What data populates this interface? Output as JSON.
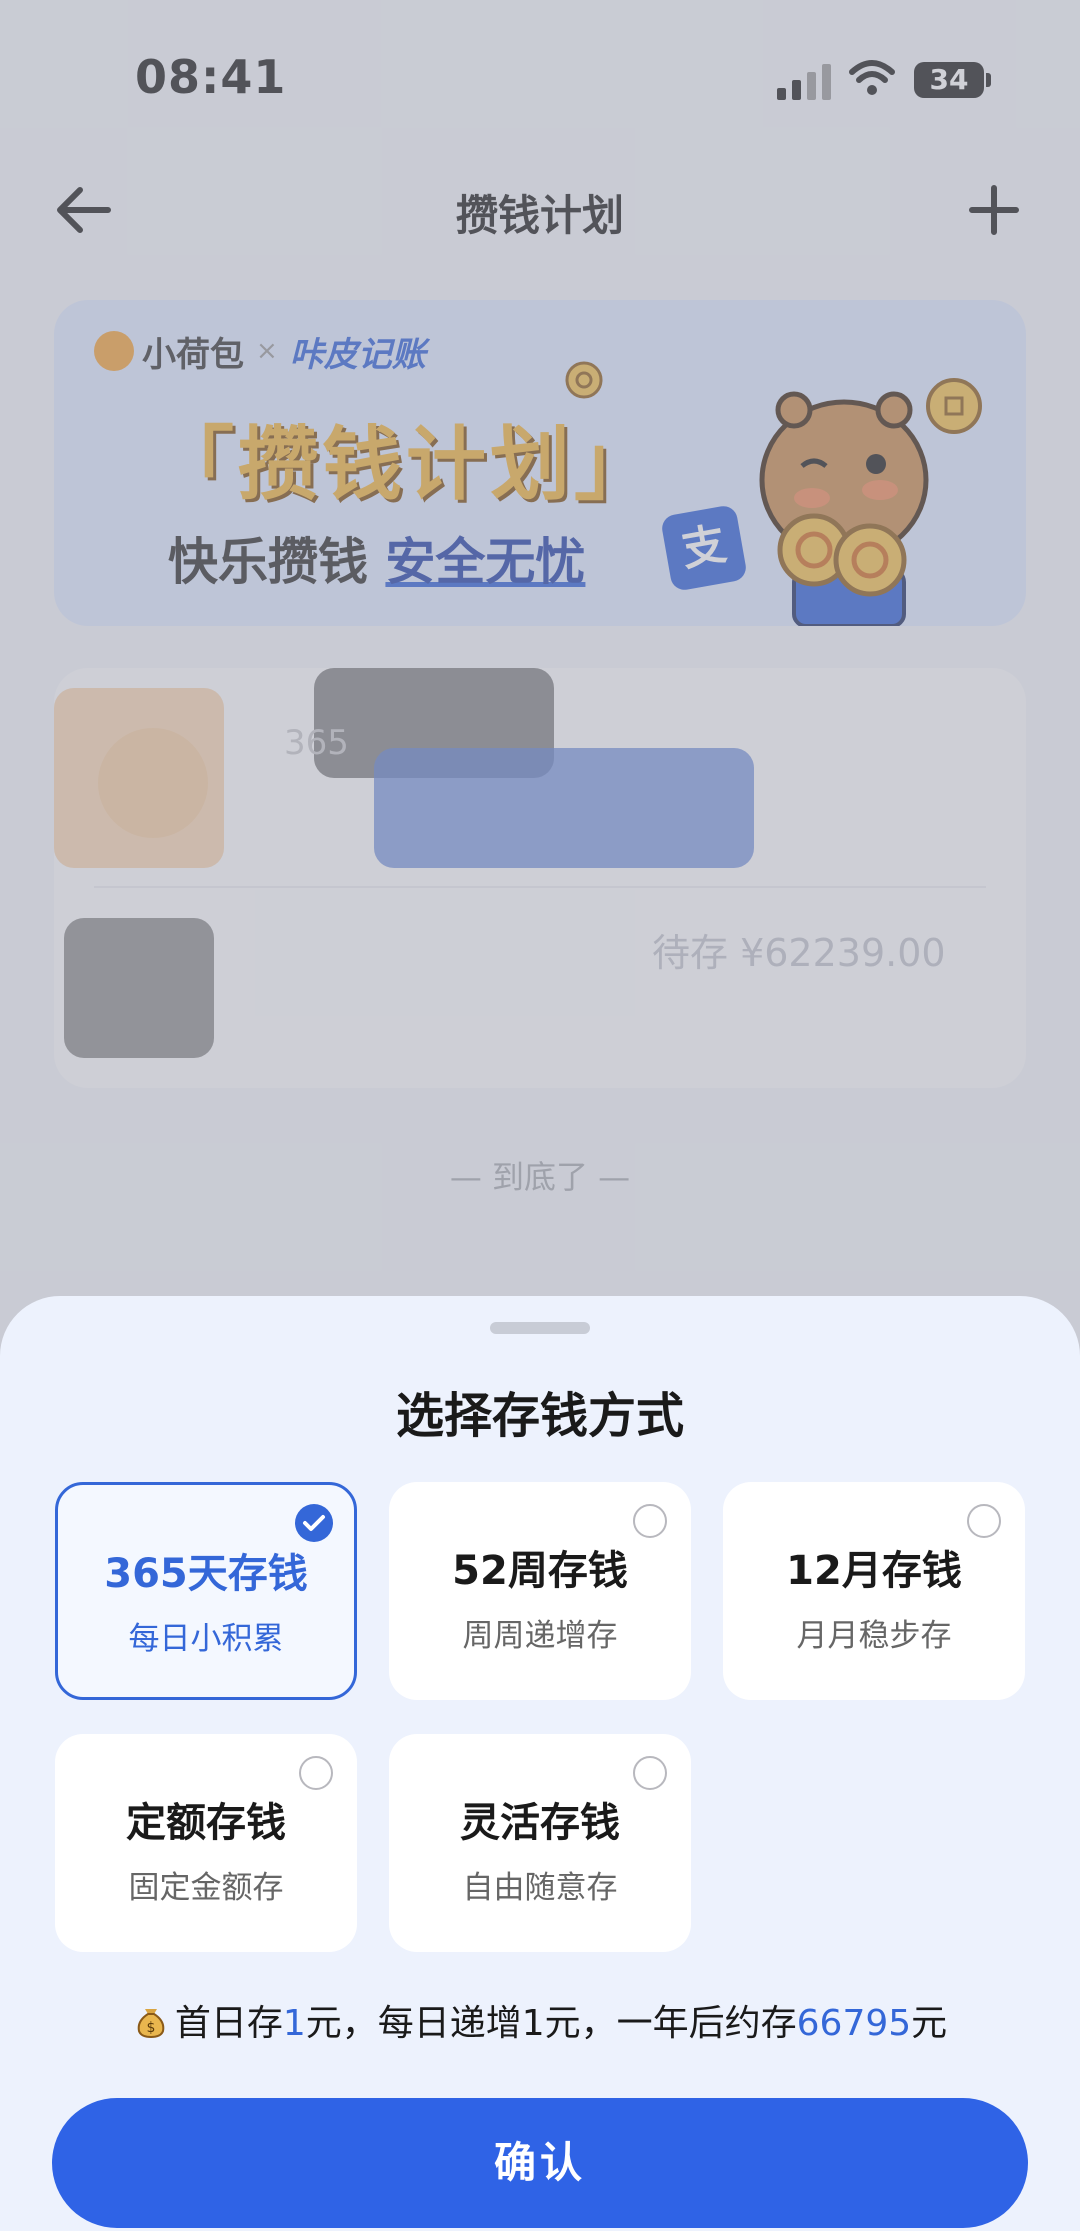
{
  "status": {
    "time": "08:41",
    "battery": "34"
  },
  "nav": {
    "title": "攒钱计划"
  },
  "banner": {
    "brand_1": "小荷包",
    "brand_x": "×",
    "brand_2": "咔皮记账",
    "title": "「攒钱计划」",
    "subtitle_a": "快乐攒钱 ",
    "subtitle_b": "安全无忧",
    "badge": "支"
  },
  "plan_card": {
    "text_1": "365",
    "amount": "待存 ¥62239.00"
  },
  "bottom_hint": "— 到底了 —",
  "sheet": {
    "title": "选择存钱方式",
    "options": [
      {
        "title": "365天存钱",
        "subtitle": "每日小积累",
        "selected": true
      },
      {
        "title": "52周存钱",
        "subtitle": "周周递增存",
        "selected": false
      },
      {
        "title": "12月存钱",
        "subtitle": "月月稳步存",
        "selected": false
      },
      {
        "title": "定额存钱",
        "subtitle": "固定金额存",
        "selected": false
      },
      {
        "title": "灵活存钱",
        "subtitle": "自由随意存",
        "selected": false
      }
    ],
    "summary": {
      "part1": "首日存",
      "first_amount": "1",
      "part2": "元，每日递增1元，一年后约存",
      "total": "66795",
      "part3": "元"
    },
    "confirm_label": "确认"
  },
  "colors": {
    "accent": "#2f63e6",
    "selected_border": "#3467d8",
    "sheet_bg": "#edf2fd"
  }
}
